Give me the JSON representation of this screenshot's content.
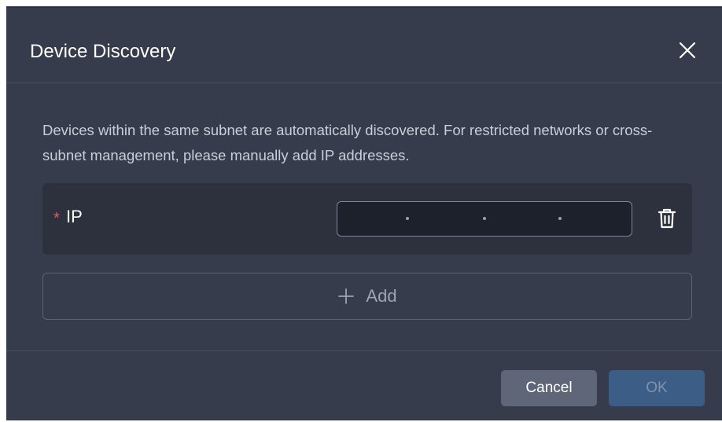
{
  "dialog": {
    "title": "Device Discovery",
    "description": "Devices within the same subnet are automatically discovered. For restricted networks or cross-subnet management, please manually add IP addresses."
  },
  "ip_row": {
    "required_mark": "*",
    "label": "IP",
    "value": ""
  },
  "actions": {
    "add_label": "Add",
    "cancel_label": "Cancel",
    "ok_label": "OK"
  },
  "icons": {
    "close": "close-icon",
    "delete": "trash-icon",
    "add": "plus-icon"
  },
  "colors": {
    "dialog_bg": "#363c4b",
    "required": "#e05c5c",
    "primary_disabled": "#3b5d86"
  }
}
